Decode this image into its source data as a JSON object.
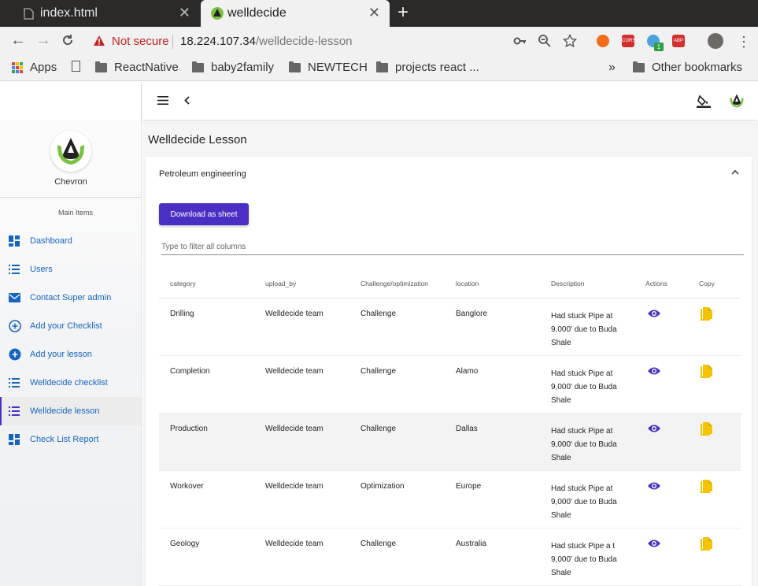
{
  "browser": {
    "tabs": [
      {
        "title": "index.html",
        "active": false
      },
      {
        "title": "welldecide",
        "active": true
      }
    ],
    "security_label": "Not secure",
    "url_host": "18.224.107.34",
    "url_path": "/welldecide-lesson",
    "bookmarks": [
      "Apps",
      "ReactNative",
      "baby2family",
      "NEWTECH",
      "projects react ...",
      "Other bookmarks"
    ],
    "extension_badge": "1",
    "ext_cors": "CORS",
    "ext_abp": "ABP"
  },
  "sidebar": {
    "org_name": "Chevron",
    "section_label": "Main Items",
    "items": [
      {
        "label": "Dashboard",
        "icon": "dashboard-icon"
      },
      {
        "label": "Users",
        "icon": "list-icon"
      },
      {
        "label": "Contact Super admin",
        "icon": "mail-icon"
      },
      {
        "label": "Add your Checklist",
        "icon": "add-circle-outline-icon"
      },
      {
        "label": "Add your lesson",
        "icon": "add-circle-icon"
      },
      {
        "label": "Welldecide checklist",
        "icon": "list-icon"
      },
      {
        "label": "Welldecide lesson",
        "icon": "list-icon",
        "active": true
      },
      {
        "label": "Check List Report",
        "icon": "dashboard-icon"
      }
    ]
  },
  "page": {
    "title": "Welldecide Lesson",
    "card_title": "Petroleum engineering",
    "download_label": "Download as sheet",
    "filter_placeholder": "Type to filter all columns"
  },
  "table": {
    "columns": [
      "category",
      "upload_by",
      "Challenge/optimization",
      "location",
      "Description",
      "Actions",
      "Copy"
    ],
    "rows": [
      {
        "category": "Drilling",
        "upload_by": "Welldecide team",
        "type": "Challenge",
        "location": "Banglore",
        "description": "Had stuck Pipe at 9,000' due to Buda Shale"
      },
      {
        "category": "Completion",
        "upload_by": "Welldecide team",
        "type": "Challenge",
        "location": "Alamo",
        "description": "Had stuck Pipe at 9,000' due to Buda Shale"
      },
      {
        "category": "Production",
        "upload_by": "Welldecide team",
        "type": "Challenge",
        "location": "Dallas",
        "description": "Had stuck Pipe at 9,000' due to Buda Shale"
      },
      {
        "category": "Workover",
        "upload_by": "Welldecide team",
        "type": "Optimization",
        "location": "Europe",
        "description": "Had stuck Pipe at 9,000' due to Buda Shale"
      },
      {
        "category": "Geology",
        "upload_by": "Welldecide team",
        "type": "Challenge",
        "location": "Australia",
        "description": "Had stuck Pipe a t 9,000' due to Buda Shale"
      }
    ]
  },
  "colors": {
    "primary": "#4b2ec3",
    "nav_link": "#1565c0",
    "copy_icon": "#f5c400",
    "logo_green": "#7cc242"
  }
}
